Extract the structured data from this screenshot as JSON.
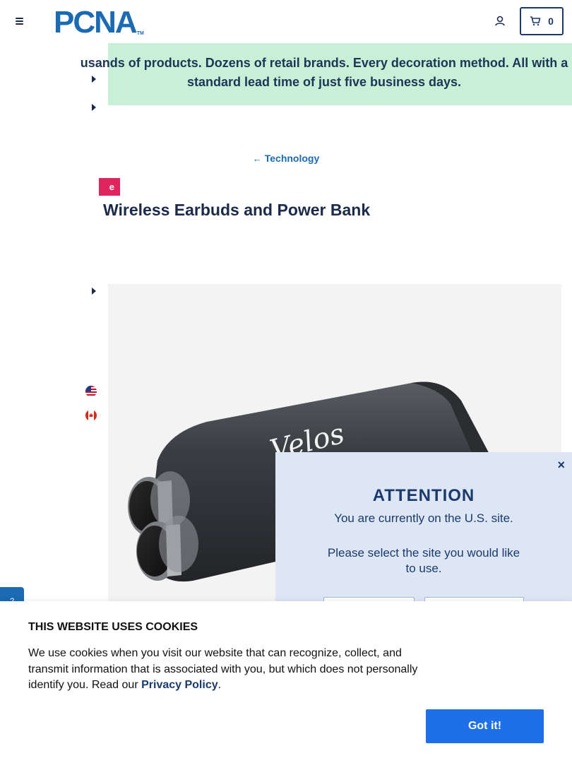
{
  "header": {
    "logo_text": "PCNA",
    "logo_tm": "TM",
    "cart_count": "0",
    "brand_color": "#1a6bb3"
  },
  "promo": {
    "text": "usands of products. Dozens of retail brands. Every decoration method. All with a standard lead time of just five business days.",
    "background": "#c8f0d6"
  },
  "breadcrumb": {
    "label": "Technology"
  },
  "product": {
    "badge": "e",
    "title": "Wireless Earbuds and Power Bank",
    "image_brand": "Velos"
  },
  "modal": {
    "close_label": "×",
    "title": "ATTENTION",
    "line1": "You are currently on the U.S. site.",
    "line2": "Please select the site you would like to use."
  },
  "chat": {
    "label": "?"
  },
  "cookie": {
    "title": "THIS WEBSITE USES COOKIES",
    "body_prefix": "We use cookies when you visit our website that can recognize, collect, and transmit information that is associated with you, but which does not personally identify you. Read our ",
    "link_label": "Privacy Policy",
    "body_suffix": ".",
    "button_label": "Got it!",
    "button_color": "#1e6fe8"
  }
}
